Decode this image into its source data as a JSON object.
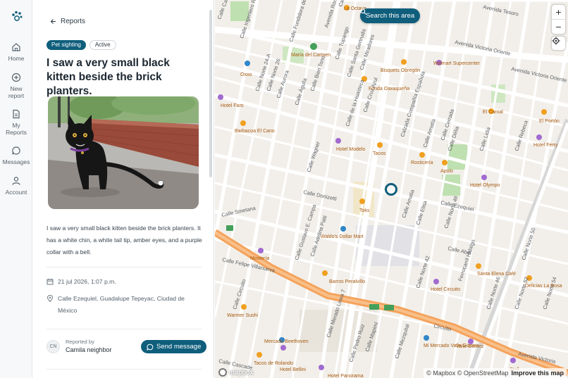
{
  "nav": {
    "items": [
      {
        "label": "Home",
        "icon": "home-icon"
      },
      {
        "label": "New report",
        "icon": "plus-circle-icon"
      },
      {
        "label": "My Reports",
        "icon": "document-icon"
      },
      {
        "label": "Messages",
        "icon": "chat-icon"
      },
      {
        "label": "Account",
        "icon": "user-icon"
      }
    ]
  },
  "panel": {
    "back_label": "Reports",
    "type_badge": "Pet sighting",
    "status_badge": "Active",
    "title": "I saw a very small black kitten beside the brick planters.",
    "description": "I saw a very small black kitten beside the brick planters. It has a white chin, a white tail tip, amber eyes, and a purple collar with a bell.",
    "date": "21 jul 2026, 1:07 p.m.",
    "location": "Calle Ezequiel, Guadalupe Tepeyac, Ciudad de México",
    "reporter_initials": "CN",
    "reported_by_label": "Reported by",
    "reporter_name": "Camila neighbor",
    "send_button": "Send message"
  },
  "map": {
    "search_button": "Search this area",
    "zoom_in": "+",
    "zoom_out": "−",
    "attribution": "© Mapbox © OpenStreetMap",
    "improve_link": "Improve this map",
    "mapbox_logo": "mapbox",
    "accent": "#0f5e7c",
    "street_labels": [
      "Calle Castro",
      "Calle Ingeniero Robles",
      "Calle Fundidora de",
      "Avenida Rom",
      "Calle Orizaba",
      "Avenida Tesoro",
      "Calle Norte 24-A",
      "Calle Norte 26",
      "Calle Aurora",
      "Calle Águila",
      "Calle Bien Tono",
      "Calle Tupango",
      "Calle Santa Gertrudis",
      "Calle Miradores",
      "Calle de la Huasteca",
      "Calle Cruz Azul",
      "Calzada Compañía Española",
      "Calle Amatla",
      "Calle Cerrada",
      "Calle Délia",
      "Calle Lidia",
      "Calle Rebeca",
      "Avenida Victoria Oriente",
      "Avenida Victoria Oriente",
      "Calle Wagner",
      "Calle Donizetti",
      "Calle Smetana",
      "Calle Gustavo E. Campa",
      "Calle Adelina Patti",
      "Calle Felipe Villanueva",
      "Calle Ezequiel",
      "Calle Abel",
      "Ferrocarril Hidalgo",
      "Calle Norte 50",
      "Calle Norte 52",
      "Calle Norte 54",
      "Calle Circuito",
      "Calle Pedro Ruiz",
      "Calle Mapimí",
      "Calle Mezquital",
      "Calle Norte 42",
      "Circuito",
      "Avenida Victoria",
      "Calle Norte 46",
      "Calle Amalia",
      "Calle Elisa",
      "Calle Norte 48",
      "Calle Merado Linea 7",
      "Calle Cascade"
    ],
    "poi_labels": [
      "La Octava",
      "María del Carmen",
      "Oxxo",
      "Bisquets Obregón",
      "Walmart Supercenter",
      "Fonda Oaxaqueña",
      "Hotel Faro",
      "Barbacoa El Cano",
      "Hotel Modelo",
      "Tacos",
      "Rosticería",
      "Apolo",
      "El Carnal",
      "El Portón",
      "Hotel Ferry",
      "Hotel Olympo",
      "Toks",
      "Waldo's Dollar Mart",
      "Mostería",
      "Barros Peralvillo",
      "Warmer Sushi",
      "Mercado Beethoven",
      "Hotel Bellini",
      "Tacos de Rolando",
      "Hotel Panorama",
      "Hotel Circuito",
      "Santa Elena Café",
      "Delicias La Rosa",
      "Mi Mercado Valle Gómez",
      "Valle Gómez",
      "Stell"
    ]
  }
}
